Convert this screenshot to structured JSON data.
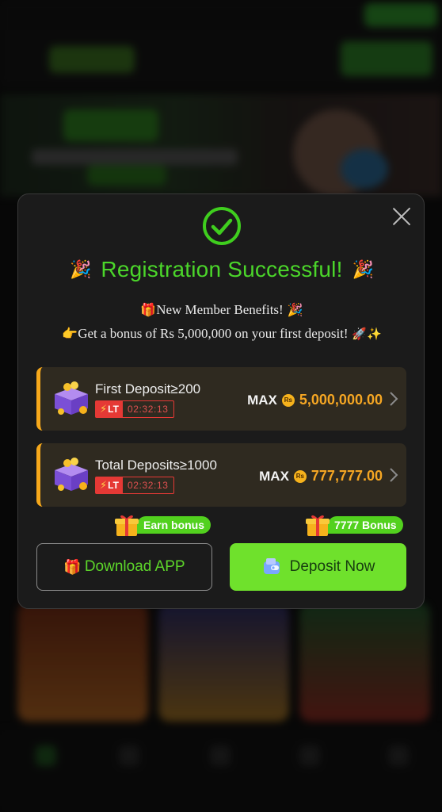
{
  "modal": {
    "title": "Registration Successful!",
    "benefits_line1": "New Member Benefits!",
    "benefits_line2": "Get a bonus of Rs 5,000,000 on your first deposit!",
    "offers": [
      {
        "label": "First Deposit≥200",
        "badge": "LT",
        "timer": "02:32:13",
        "max_label": "MAX",
        "currency": "Rs",
        "amount": "5,000,000.00"
      },
      {
        "label": "Total Deposits≥1000",
        "badge": "LT",
        "timer": "02:32:13",
        "max_label": "MAX",
        "currency": "Rs",
        "amount": "777,777.00"
      }
    ],
    "download": {
      "tag": "Earn bonus",
      "label": "Download APP"
    },
    "deposit": {
      "tag": "7777 Bonus",
      "label": "Deposit Now"
    }
  },
  "colors": {
    "accent_green": "#4bd62a",
    "button_green": "#6fe12c",
    "offer_border": "#f6a81b",
    "amount_gold": "#f5a623",
    "timer_red": "#e53935"
  },
  "icons": [
    "check-circle-icon",
    "close-icon",
    "party-popper-icon",
    "gift-icon",
    "pointing-hand-icon",
    "rocket-icon",
    "sparkles-icon",
    "treasure-box-icon",
    "lightning-icon",
    "coin-icon",
    "chevron-right-icon",
    "deposit-wallet-icon"
  ]
}
